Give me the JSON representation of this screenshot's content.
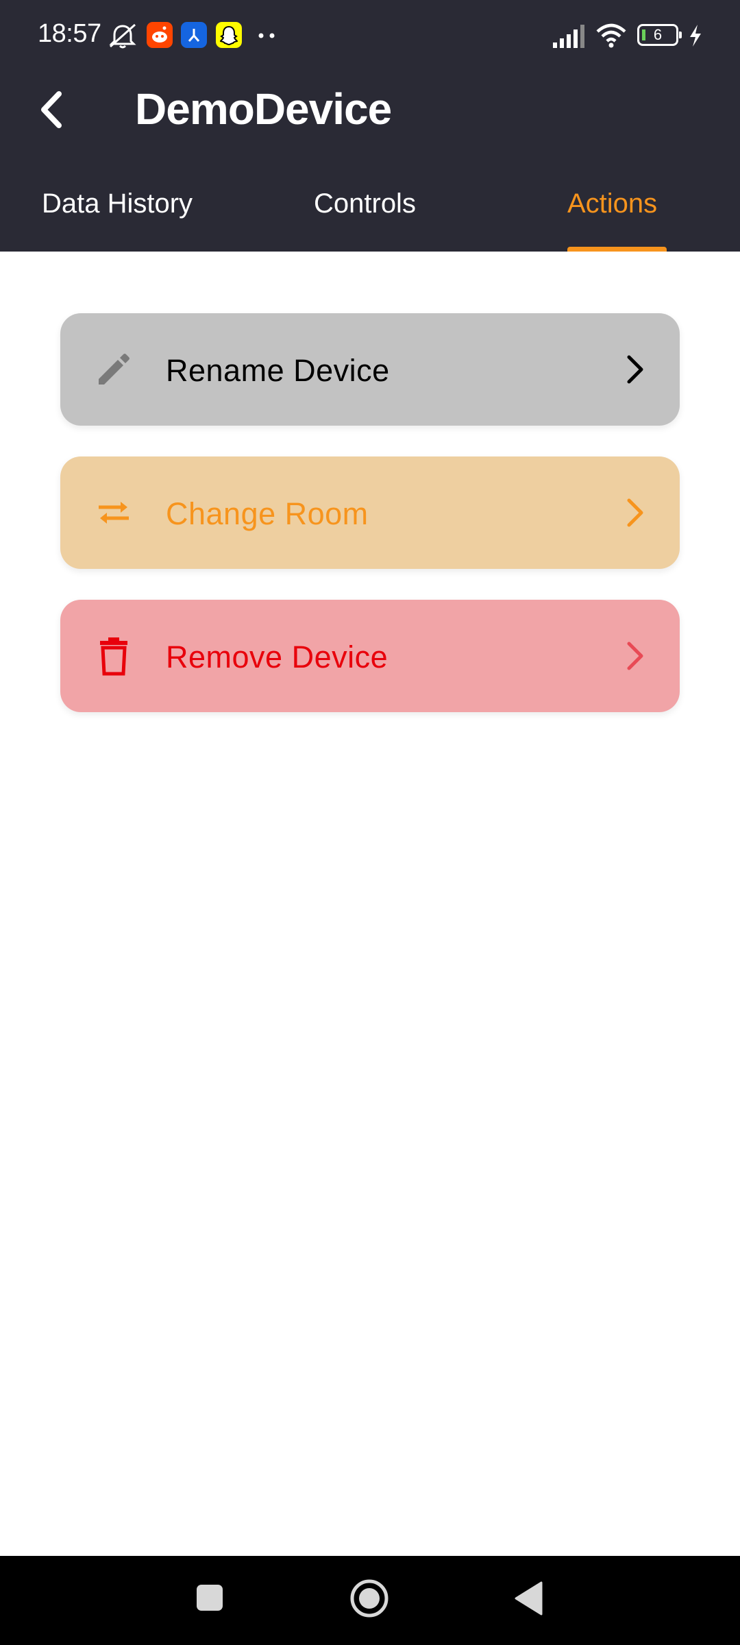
{
  "status_bar": {
    "time": "18:57",
    "battery": "6",
    "icons": [
      "dnd-bell-icon",
      "reddit-icon",
      "app-icon",
      "snapchat-icon",
      "more-dots-icon",
      "signal-icon",
      "wifi-icon",
      "battery-icon",
      "charging-icon"
    ]
  },
  "app_bar": {
    "title": "DemoDevice",
    "back_icon": "chevron-left-icon"
  },
  "tabs": [
    {
      "label": "Data History",
      "active": false
    },
    {
      "label": "Controls",
      "active": false
    },
    {
      "label": "Actions",
      "active": true
    }
  ],
  "actions": [
    {
      "label": "Rename Device",
      "icon": "pencil-icon",
      "bg": "#c2c2c2",
      "color": "#000000",
      "icon_color": "#7a7a7a"
    },
    {
      "label": "Change Room",
      "icon": "swap-arrows-icon",
      "bg": "#eecfa0",
      "color": "#f7941d",
      "icon_color": "#f7941d"
    },
    {
      "label": "Remove Device",
      "icon": "trash-icon",
      "bg": "#f1a4a7",
      "color": "#e8000b",
      "icon_color": "#e8000b"
    }
  ],
  "nav_bar": {
    "icons": [
      "recents-square-icon",
      "home-circle-icon",
      "back-triangle-icon"
    ]
  },
  "colors": {
    "header_bg": "#2a2a35",
    "accent": "#f7941d"
  }
}
